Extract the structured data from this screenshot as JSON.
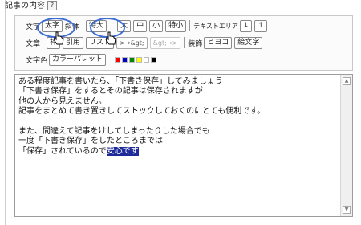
{
  "section": {
    "title": "記事の内容",
    "help": "?"
  },
  "toolbar": {
    "row1": {
      "label": "文字",
      "buttons": [
        "太字",
        "斜体",
        "特大",
        "大",
        "中",
        "小",
        "特小"
      ],
      "textarea_label": "テキストエリア",
      "down": "↓",
      "up": "↑"
    },
    "row2": {
      "label": "文章",
      "buttons": [
        "枠",
        "引用",
        "リスト",
        ">→&gt;",
        "&gt;→>"
      ],
      "decor_label": "装飾",
      "decor_buttons": [
        "ヒヨコ",
        "絵文字"
      ]
    },
    "row3": {
      "label": "文字色",
      "palette_button": "カラーパレット",
      "swatches": [
        "#ff0000",
        "#0000cc",
        "#008800",
        "#ffff00",
        "#ffffff",
        "#000000"
      ]
    }
  },
  "editor": {
    "lines": [
      "ある程度記事を書いたら、「下書き保存」してみましょう",
      "「下書き保存」をするとその記事は保存されますが",
      "他の人から見えません。",
      "記事をまとめて書き置きしてストックしておくのにとても便利です。",
      "",
      "また、間違えて記事をけしてしまったりした場合でも",
      "一度「下書き保存」をしたところまでは"
    ],
    "last_line_prefix": "「保存」されているので",
    "selected_text": "安心です"
  }
}
